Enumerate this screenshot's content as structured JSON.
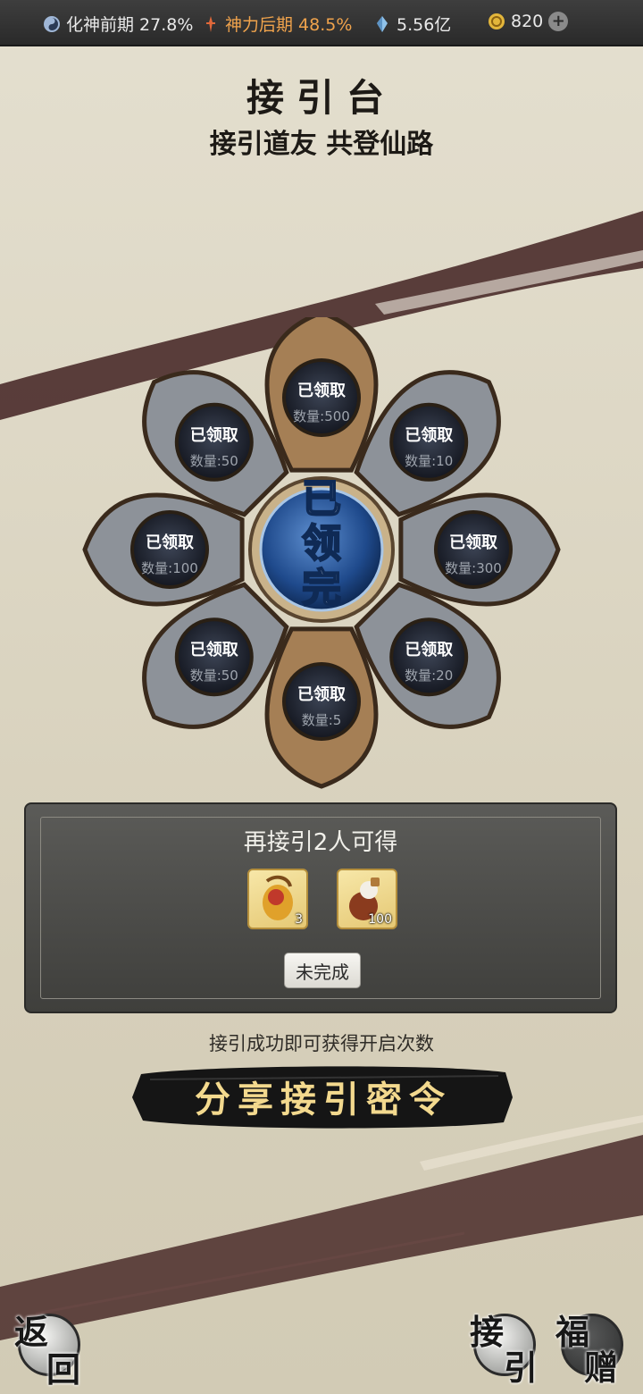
{
  "topbar": {
    "realm": "化神前期 27.8%",
    "power": "神力后期 48.5%",
    "spirit": "5.56亿",
    "gold": "820",
    "colors": {
      "power": "#f0a34c",
      "text": "#eaeaea"
    }
  },
  "header": {
    "title": "接引台",
    "subtitle": "接引道友 共登仙路"
  },
  "wheel": {
    "center_label": [
      "已",
      "领",
      "完"
    ],
    "slots": [
      {
        "label": "已领取",
        "qty": "数量:500"
      },
      {
        "label": "已领取",
        "qty": "数量:10"
      },
      {
        "label": "已领取",
        "qty": "数量:300"
      },
      {
        "label": "已领取",
        "qty": "数量:20"
      },
      {
        "label": "已领取",
        "qty": "数量:5"
      },
      {
        "label": "已领取",
        "qty": "数量:50"
      },
      {
        "label": "已领取",
        "qty": "数量:100"
      },
      {
        "label": "已领取",
        "qty": "数量:50"
      }
    ]
  },
  "task_panel": {
    "title": "再接引2人可得",
    "rewards": [
      {
        "icon": "treasure-bag-icon",
        "count": "3"
      },
      {
        "icon": "elixir-gourd-icon",
        "count": "100"
      }
    ],
    "status_button": "未完成"
  },
  "hint": "接引成功即可获得开启次数",
  "share_button": "分享接引密令",
  "bottom_nav": {
    "back": [
      "返",
      "回"
    ],
    "invite": [
      "接",
      "引"
    ],
    "gift": [
      "福",
      "赠"
    ]
  }
}
